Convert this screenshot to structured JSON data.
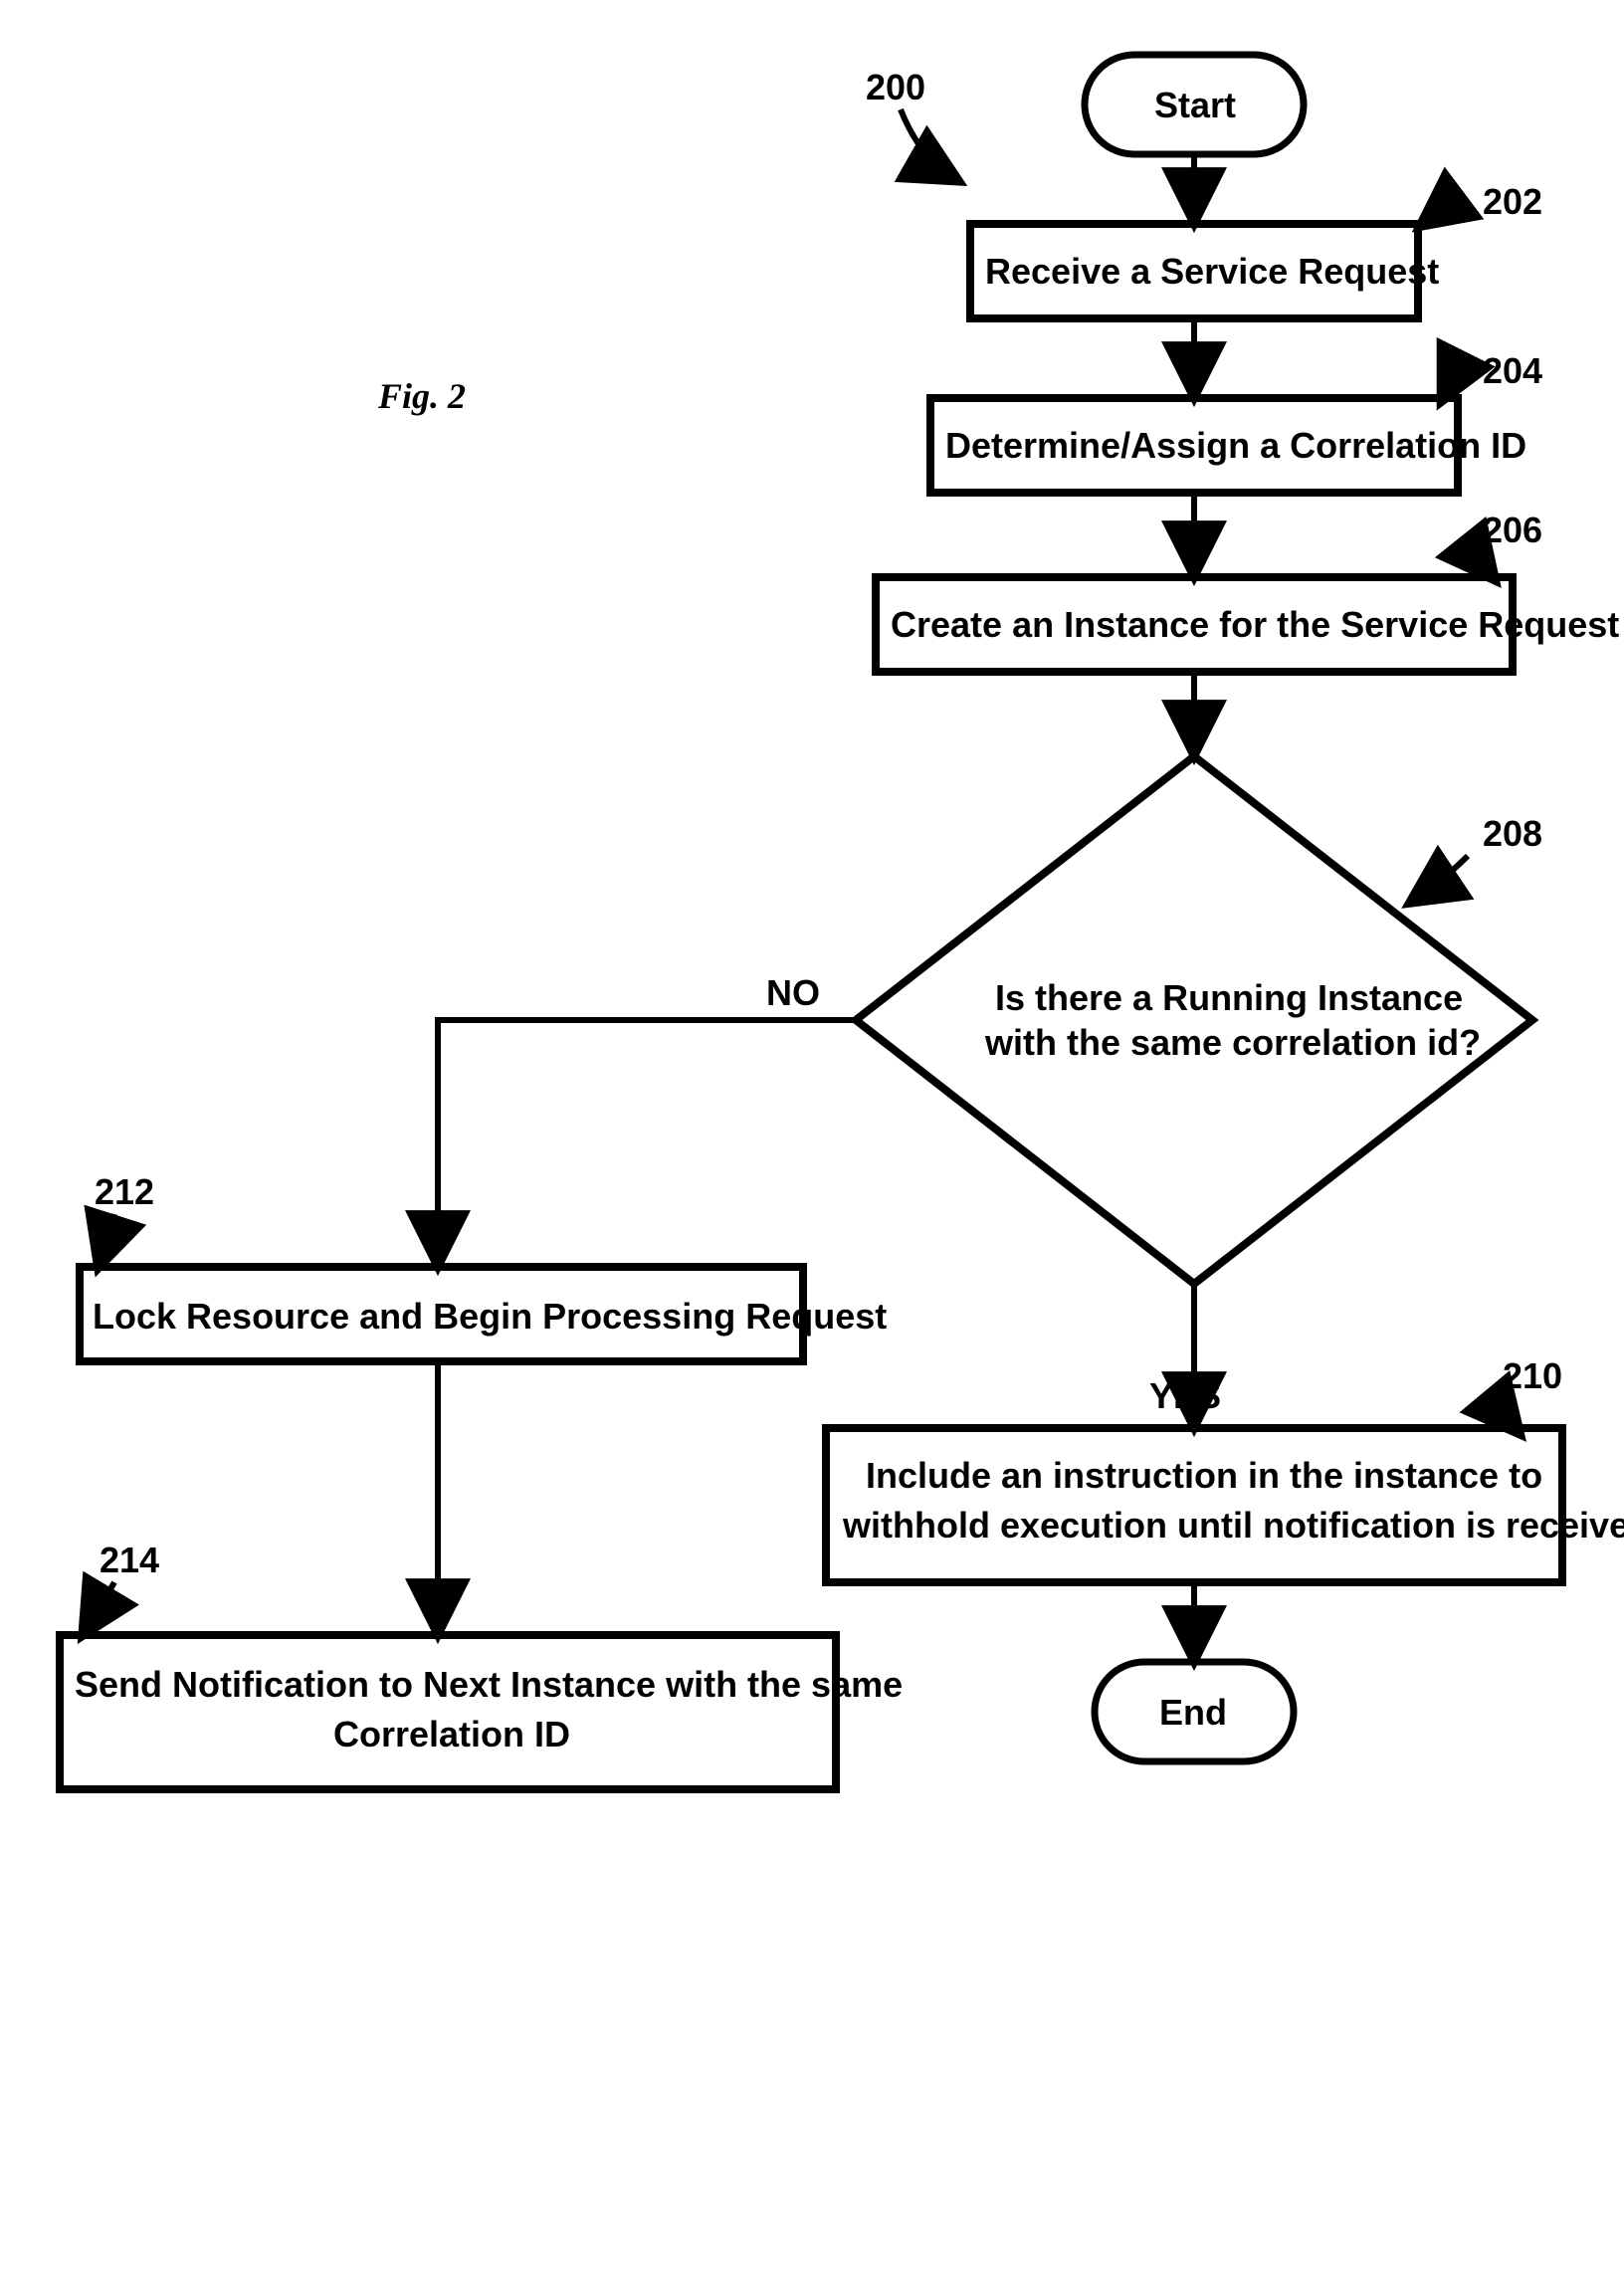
{
  "figure_label": "Fig. 2",
  "ref_label": "200",
  "nodes": {
    "start": "Start",
    "end": "End",
    "step202": {
      "text": "Receive a Service Request",
      "ref": "202"
    },
    "step204": {
      "text": "Determine/Assign a Correlation ID",
      "ref": "204"
    },
    "step206": {
      "text": "Create an Instance for the Service Request",
      "ref": "206"
    },
    "decision208": {
      "line1": "Is there a Running Instance",
      "line2": "with the same correlation id?",
      "ref": "208"
    },
    "step210": {
      "line1": "Include an instruction in the instance to",
      "line2": "withhold execution until notification is received",
      "ref": "210"
    },
    "step212": {
      "text": "Lock Resource and Begin Processing Request",
      "ref": "212"
    },
    "step214": {
      "line1": "Send Notification to Next Instance with the same",
      "line2": "Correlation ID",
      "ref": "214"
    }
  },
  "edges": {
    "yes": "YES",
    "no": "NO"
  }
}
